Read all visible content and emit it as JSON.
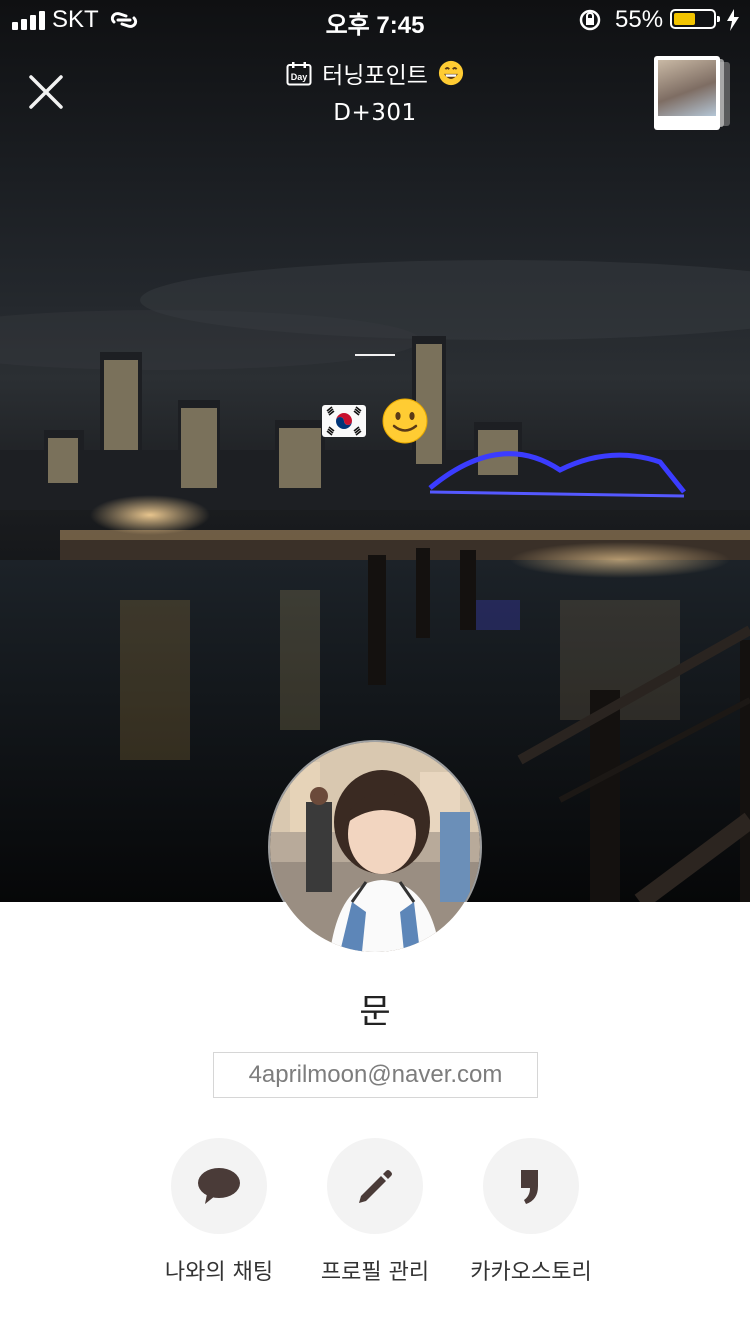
{
  "status_bar": {
    "carrier": "SKT",
    "time": "오후 7:45",
    "battery_percent": "55%",
    "battery_level": 0.55,
    "battery_color": "#f2c400"
  },
  "header": {
    "close_icon": "close-x-icon",
    "title": "터닝포인트",
    "title_emoji": "grinning-face-emoji",
    "dday": "D+301"
  },
  "profile": {
    "status_emojis": [
      "south-korea-flag-emoji",
      "slightly-smiling-face-emoji"
    ],
    "name": "문",
    "email": "4aprilmoon@naver.com"
  },
  "actions": [
    {
      "label": "나와의 채팅",
      "icon": "speech-bubble-icon"
    },
    {
      "label": "프로필 관리",
      "icon": "pencil-icon"
    },
    {
      "label": "카카오스토리",
      "icon": "quote-mark-icon"
    }
  ],
  "colors": {
    "icon_brown": "#4a3b38",
    "action_bg": "#f3f3f3",
    "bridge_blue": "#3b3cff"
  }
}
